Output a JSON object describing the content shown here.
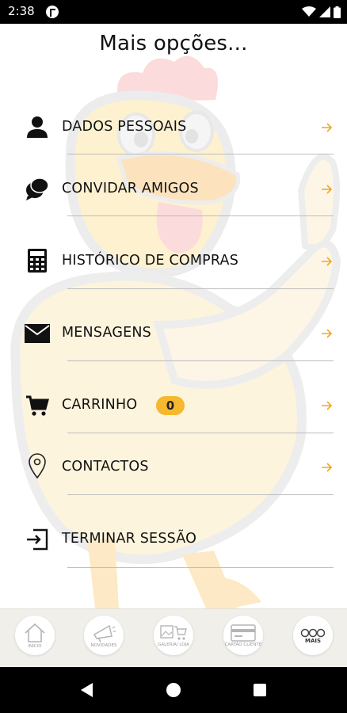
{
  "status_bar": {
    "time": "2:38",
    "icons": [
      "app-notification-icon",
      "wifi-icon",
      "cell-signal-icon",
      "battery-icon"
    ]
  },
  "page": {
    "title": "Mais opções..."
  },
  "menu": [
    {
      "id": "dados",
      "label": "DADOS PESSOAIS",
      "icon": "person-icon"
    },
    {
      "id": "convidar",
      "label": "CONVIDAR AMIGOS",
      "icon": "chat-bubbles-icon"
    },
    {
      "id": "historico",
      "label": "HISTÓRICO DE COMPRAS",
      "icon": "calculator-icon"
    },
    {
      "id": "mensagens",
      "label": "MENSAGENS",
      "icon": "envelope-icon"
    },
    {
      "id": "carrinho",
      "label": "CARRINHO",
      "icon": "cart-icon",
      "badge": "0"
    },
    {
      "id": "contactos",
      "label": "CONTACTOS",
      "icon": "location-pin-icon"
    },
    {
      "id": "terminar",
      "label": "TERMINAR SESSÃO",
      "icon": "logout-icon"
    }
  ],
  "tabs": [
    {
      "label": "INICIO",
      "icon": "home-icon"
    },
    {
      "label": "NOVIDADES",
      "icon": "megaphone-icon"
    },
    {
      "label": "GALERIA/ LOJA",
      "icon": "gallery-cart-icon"
    },
    {
      "label": "CARTÃO CLIENTE",
      "icon": "card-icon"
    },
    {
      "label": "MAIS",
      "icon": "more-icon",
      "active": true
    }
  ],
  "colors": {
    "accent": "#f5b82e",
    "arrow": "#f0a820",
    "divider": "#bdbdbd",
    "tab_bar": "#f1efea",
    "status_bar": "#000000"
  },
  "nav_bar": {
    "icons": [
      "back-icon",
      "home-button-icon",
      "recents-icon"
    ]
  }
}
